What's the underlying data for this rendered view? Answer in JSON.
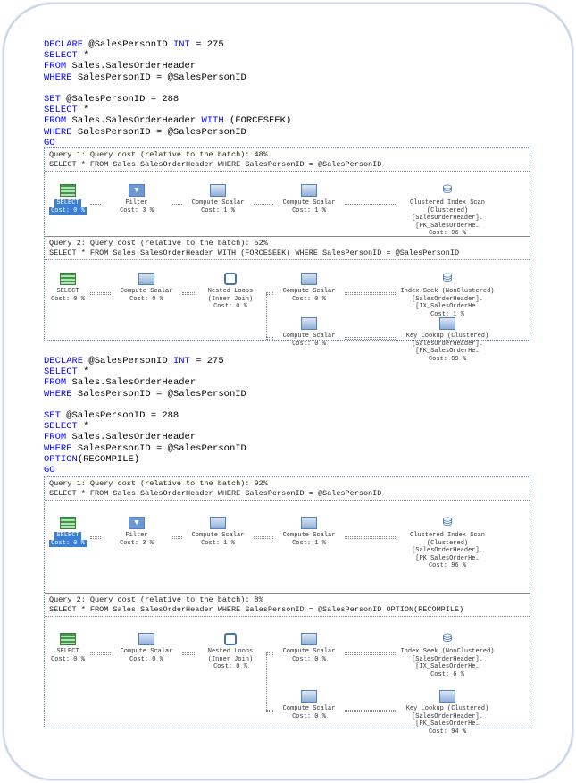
{
  "code_blocks": [
    [
      [
        {
          "t": "DECLARE",
          "k": 1
        },
        {
          "t": " @SalesPersonID "
        },
        {
          "t": "INT",
          "k": 1
        },
        {
          "t": " = 275"
        }
      ],
      [
        {
          "t": "SELECT",
          "k": 1
        },
        {
          "t": " *"
        }
      ],
      [
        {
          "t": "FROM",
          "k": 1
        },
        {
          "t": " Sales.SalesOrderHeader"
        }
      ],
      [
        {
          "t": "WHERE",
          "k": 1
        },
        {
          "t": " SalesPersonID = @SalesPersonID"
        }
      ],
      [],
      [
        {
          "t": "SET",
          "k": 1
        },
        {
          "t": " @SalesPersonID = 288"
        }
      ],
      [
        {
          "t": "SELECT",
          "k": 1
        },
        {
          "t": " *"
        }
      ],
      [
        {
          "t": "FROM",
          "k": 1
        },
        {
          "t": " Sales.SalesOrderHeader "
        },
        {
          "t": "WITH",
          "k": 1
        },
        {
          "t": " (FORCESEEK)"
        }
      ],
      [
        {
          "t": "WHERE",
          "k": 1
        },
        {
          "t": " SalesPersonID = @SalesPersonID"
        }
      ],
      [
        {
          "t": "GO",
          "k": 1
        }
      ]
    ],
    [
      [
        {
          "t": "DECLARE",
          "k": 1
        },
        {
          "t": " @SalesPersonID "
        },
        {
          "t": "INT",
          "k": 1
        },
        {
          "t": " = 275"
        }
      ],
      [
        {
          "t": "SELECT",
          "k": 1
        },
        {
          "t": " *"
        }
      ],
      [
        {
          "t": "FROM",
          "k": 1
        },
        {
          "t": " Sales.SalesOrderHeader"
        }
      ],
      [
        {
          "t": "WHERE",
          "k": 1
        },
        {
          "t": " SalesPersonID = @SalesPersonID"
        }
      ],
      [],
      [
        {
          "t": "SET",
          "k": 1
        },
        {
          "t": " @SalesPersonID = 288"
        }
      ],
      [
        {
          "t": "SELECT",
          "k": 1
        },
        {
          "t": " *"
        }
      ],
      [
        {
          "t": "FROM",
          "k": 1
        },
        {
          "t": " Sales.SalesOrderHeader"
        }
      ],
      [
        {
          "t": "WHERE",
          "k": 1
        },
        {
          "t": " SalesPersonID = @SalesPersonID"
        }
      ],
      [
        {
          "t": "OPTION",
          "k": 1
        },
        {
          "t": "(RECOMPILE)"
        }
      ],
      [
        {
          "t": "GO",
          "k": 1
        }
      ]
    ]
  ],
  "plans": [
    [
      {
        "title": "Query 1: Query cost (relative to the batch): 48%",
        "statement": "SELECT * FROM Sales.SalesOrderHeader WHERE SalesPersonID = @SalesPersonID",
        "nodes": [
          {
            "icon": "select-icon",
            "lines": [
              "SELECT",
              "Cost: 0 %"
            ],
            "selected": true
          },
          {
            "icon": "filter-icon",
            "lines": [
              "Filter",
              "Cost: 3 %"
            ]
          },
          {
            "icon": "compute-scalar-icon",
            "lines": [
              "Compute Scalar",
              "Cost: 1 %"
            ]
          },
          {
            "icon": "compute-scalar-icon",
            "lines": [
              "Compute Scalar",
              "Cost: 1 %"
            ]
          },
          {
            "icon": "clustered-index-scan-icon",
            "lines": [
              "Clustered Index Scan (Clustered)",
              "[SalesOrderHeader].[PK_SalesOrderHe…",
              "Cost: 96 %"
            ]
          }
        ]
      },
      {
        "title": "Query 2: Query cost (relative to the batch): 52%",
        "statement": "SELECT * FROM Sales.SalesOrderHeader WITH (FORCESEEK) WHERE SalesPersonID = @SalesPersonID",
        "nodes": [
          {
            "icon": "select-icon",
            "lines": [
              "SELECT",
              "Cost: 0 %"
            ]
          },
          {
            "icon": "compute-scalar-icon",
            "lines": [
              "Compute Scalar",
              "Cost: 0 %"
            ]
          },
          {
            "icon": "nested-loops-icon",
            "lines": [
              "Nested Loops",
              "(Inner Join)",
              "Cost: 0 %"
            ]
          },
          {
            "icon": "compute-scalar-icon",
            "lines": [
              "Compute Scalar",
              "Cost: 0 %"
            ]
          },
          {
            "icon": "index-seek-icon",
            "lines": [
              "Index Seek (NonClustered)",
              "[SalesOrderHeader].[IX_SalesOrderHe…",
              "Cost: 1 %"
            ]
          },
          {
            "icon": "compute-scalar-icon",
            "lines": [
              "Compute Scalar",
              "Cost: 0 %"
            ]
          },
          {
            "icon": "key-lookup-icon",
            "lines": [
              "Key Lookup (Clustered)",
              "[SalesOrderHeader].[PK_SalesOrderHe…",
              "Cost: 99 %"
            ]
          }
        ]
      }
    ],
    [
      {
        "title": "Query 1: Query cost (relative to the batch): 92%",
        "statement": "SELECT * FROM Sales.SalesOrderHeader WHERE SalesPersonID = @SalesPersonID",
        "nodes": [
          {
            "icon": "select-icon",
            "lines": [
              "SELECT",
              "Cost: 0 %"
            ],
            "selected": true
          },
          {
            "icon": "filter-icon",
            "lines": [
              "Filter",
              "Cost: 3 %"
            ]
          },
          {
            "icon": "compute-scalar-icon",
            "lines": [
              "Compute Scalar",
              "Cost: 1 %"
            ]
          },
          {
            "icon": "compute-scalar-icon",
            "lines": [
              "Compute Scalar",
              "Cost: 1 %"
            ]
          },
          {
            "icon": "clustered-index-scan-icon",
            "lines": [
              "Clustered Index Scan (Clustered)",
              "[SalesOrderHeader].[PK_SalesOrderHe…",
              "Cost: 96 %"
            ]
          }
        ]
      },
      {
        "title": "Query 2: Query cost (relative to the batch): 8%",
        "statement": "SELECT * FROM Sales.SalesOrderHeader WHERE SalesPersonID = @SalesPersonID OPTION(RECOMPILE)",
        "nodes": [
          {
            "icon": "select-icon",
            "lines": [
              "SELECT",
              "Cost: 0 %"
            ]
          },
          {
            "icon": "compute-scalar-icon",
            "lines": [
              "Compute Scalar",
              "Cost: 0 %"
            ]
          },
          {
            "icon": "nested-loops-icon",
            "lines": [
              "Nested Loops",
              "(Inner Join)",
              "Cost: 0 %"
            ]
          },
          {
            "icon": "compute-scalar-icon",
            "lines": [
              "Compute Scalar",
              "Cost: 0 %"
            ]
          },
          {
            "icon": "index-seek-icon",
            "lines": [
              "Index Seek (NonClustered)",
              "[SalesOrderHeader].[IX_SalesOrderHe…",
              "Cost: 6 %"
            ]
          },
          {
            "icon": "compute-scalar-icon",
            "lines": [
              "Compute Scalar",
              "Cost: 0 %"
            ]
          },
          {
            "icon": "key-lookup-icon",
            "lines": [
              "Key Lookup (Clustered)",
              "[SalesOrderHeader].[PK_SalesOrderHe…",
              "Cost: 94 %"
            ]
          }
        ]
      }
    ]
  ]
}
